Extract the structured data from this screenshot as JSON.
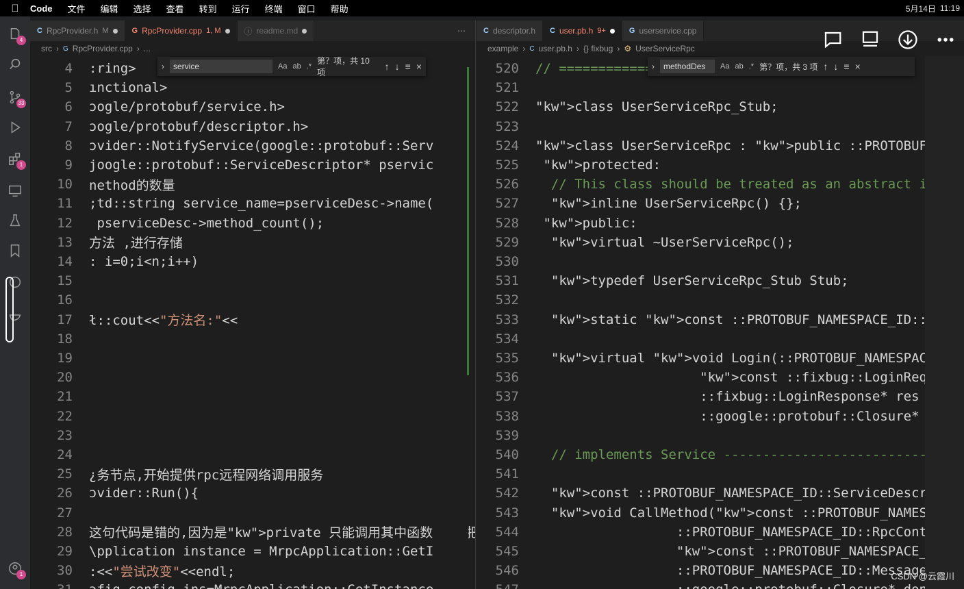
{
  "menubar": {
    "app": "Code",
    "items": [
      "文件",
      "编辑",
      "选择",
      "查看",
      "转到",
      "运行",
      "终端",
      "窗口",
      "帮助"
    ],
    "date": "5月14日",
    "time": "11:19"
  },
  "activity": {
    "explorer_badge": "4",
    "scm_badge": "33",
    "ext_badge": "1",
    "account_badge": "1"
  },
  "left": {
    "tabs": [
      {
        "label": "RpcProvider.h",
        "status": "M"
      },
      {
        "label": "RpcProvider.cpp",
        "status": "1, M"
      },
      {
        "label": "readme.md",
        "status": ""
      }
    ],
    "breadcrumb": [
      "src",
      "RpcProvider.cpp",
      "..."
    ],
    "find": {
      "value": "service",
      "result": "第？项，共 10 项"
    },
    "lines": [
      {
        "n": "4",
        "t": ":ring>"
      },
      {
        "n": "5",
        "t": "ınctional>"
      },
      {
        "n": "6",
        "t": "ɔogle/protobuf/service.h>"
      },
      {
        "n": "7",
        "t": "ɔogle/protobuf/descriptor.h>"
      },
      {
        "n": "8",
        "t": "ɔvider::NotifyService(google::protobuf::Servi"
      },
      {
        "n": "9",
        "t": "joogle::protobuf::ServiceDescriptor* pservice"
      },
      {
        "n": "10",
        "t": "nethod的数量"
      },
      {
        "n": "11",
        "t": ";td::string service_name=pserviceDesc->name()"
      },
      {
        "n": "12",
        "t": " pserviceDesc->method_count();"
      },
      {
        "n": "13",
        "t": "方法 ,进行存储"
      },
      {
        "n": "14",
        "t": ": i=0;i<n;i++)"
      },
      {
        "n": "15",
        "t": ""
      },
      {
        "n": "16",
        "t": ""
      },
      {
        "n": "17",
        "t": "ł::cout<<\"方法名:\"<<"
      },
      {
        "n": "18",
        "t": ""
      },
      {
        "n": "19",
        "t": ""
      },
      {
        "n": "20",
        "t": ""
      },
      {
        "n": "21",
        "t": ""
      },
      {
        "n": "22",
        "t": ""
      },
      {
        "n": "23",
        "t": ""
      },
      {
        "n": "24",
        "t": ""
      },
      {
        "n": "25",
        "t": "¿务节点,开始提供rpc远程网络调用服务"
      },
      {
        "n": "26",
        "t": "ɔvider::Run(){"
      },
      {
        "n": "27",
        "t": ""
      },
      {
        "n": "28",
        "t": "这句代码是错的,因为是private 只能调用其中函数,不能把"
      },
      {
        "n": "29",
        "t": "\\pplication instance = MrpcApplication::GetIn"
      },
      {
        "n": "30",
        "t": ":<<\"尝试改变\"<<endl;"
      },
      {
        "n": "31",
        "t": "ɔfig config_ins=MrpcApplication::GetInstance("
      }
    ]
  },
  "right": {
    "tabs": [
      {
        "label": "descriptor.h",
        "status": ""
      },
      {
        "label": "user.pb.h",
        "status": "9+"
      },
      {
        "label": "userservice.cpp",
        "status": ""
      }
    ],
    "breadcrumb": [
      "example",
      "user.pb.h",
      "{} fixbug",
      "UserServiceRpc"
    ],
    "find": {
      "value": "methodDes",
      "result": "第？项，共 3 项"
    },
    "lines": [
      {
        "n": "520",
        "t": "// =============="
      },
      {
        "n": "521",
        "t": ""
      },
      {
        "n": "522",
        "t": "class UserServiceRpc_Stub;"
      },
      {
        "n": "523",
        "t": ""
      },
      {
        "n": "524",
        "t": "class UserServiceRpc : public ::PROTOBUF_NAMESPACE_"
      },
      {
        "n": "525",
        "t": " protected:"
      },
      {
        "n": "526",
        "t": "  // This class should be treated as an abstract in"
      },
      {
        "n": "527",
        "t": "  inline UserServiceRpc() {};"
      },
      {
        "n": "528",
        "t": " public:"
      },
      {
        "n": "529",
        "t": "  virtual ~UserServiceRpc();"
      },
      {
        "n": "530",
        "t": ""
      },
      {
        "n": "531",
        "t": "  typedef UserServiceRpc_Stub Stub;"
      },
      {
        "n": "532",
        "t": ""
      },
      {
        "n": "533",
        "t": "  static const ::PROTOBUF_NAMESPACE_ID::ServiceDesc"
      },
      {
        "n": "534",
        "t": ""
      },
      {
        "n": "535",
        "t": "  virtual void Login(::PROTOBUF_NAMESPACE_ID::RpcCo"
      },
      {
        "n": "536",
        "t": "                     const ::fixbug::LoginRequest"
      },
      {
        "n": "537",
        "t": "                     ::fixbug::LoginResponse* res"
      },
      {
        "n": "538",
        "t": "                     ::google::protobuf::Closure*"
      },
      {
        "n": "539",
        "t": ""
      },
      {
        "n": "540",
        "t": "  // implements Service ----------------------------"
      },
      {
        "n": "541",
        "t": ""
      },
      {
        "n": "542",
        "t": "  const ::PROTOBUF_NAMESPACE_ID::ServiceDescriptor*"
      },
      {
        "n": "543",
        "t": "  void CallMethod(const ::PROTOBUF_NAMESPACE_ID::Me"
      },
      {
        "n": "544",
        "t": "                  ::PROTOBUF_NAMESPACE_ID::RpcCont"
      },
      {
        "n": "545",
        "t": "                  const ::PROTOBUF_NAMESPACE_ID::Me"
      },
      {
        "n": "546",
        "t": "                  ::PROTOBUF_NAMESPACE_ID::Message"
      },
      {
        "n": "547",
        "t": "                  ::google::protobuf::Closure* done"
      }
    ]
  },
  "watermark": "CSDN @云霞川"
}
